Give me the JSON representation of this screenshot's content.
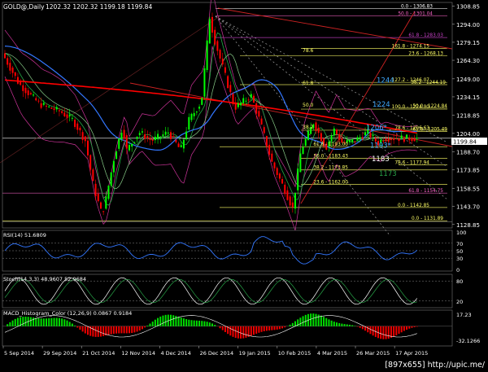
{
  "window": {
    "title": "GOLD@,Daily",
    "ohlc": "1202.32 1202.32 1199.18 1199.84",
    "watermark": "[897x655] http://upic.me/"
  },
  "price_axis": {
    "labels": [
      "1308.85",
      "1294.00",
      "1279.15",
      "1264.30",
      "1249.00",
      "1234.15",
      "1218.85",
      "1204.00",
      "1188.70",
      "1173.85",
      "1158.55",
      "1143.70",
      "1128.85"
    ],
    "current": "1199.84",
    "range": [
      1126,
      1312
    ]
  },
  "date_axis": [
    "5 Sep 2014",
    "29 Sep 2014",
    "21 Oct 2014",
    "12 Nov 2014",
    "4 Dec 2014",
    "26 Dec 2014",
    "19 Jan 2015",
    "10 Feb 2015",
    "4 Mar 2015",
    "26 Mar 2015",
    "17 Apr 2015"
  ],
  "fib_right": [
    {
      "label": "0.0 - 1306.83",
      "price": 1306.83,
      "color": "#ffffff"
    },
    {
      "label": "50.0 - 1301.04",
      "price": 1301.04,
      "color": "#ff66cc"
    },
    {
      "label": "61.8 - 1283.03",
      "price": 1283.03,
      "color": "#cc44cc"
    },
    {
      "label": "161.8 - 1274.15",
      "price": 1274.15,
      "color": "#ffff66"
    },
    {
      "label": "23.6 - 1268.13",
      "price": 1268.13,
      "color": "#ffff66"
    },
    {
      "label": "127.2 - 1246.07",
      "price": 1246.07,
      "color": "#ffff66"
    },
    {
      "label": "38.2 - 1244.19",
      "price": 1244.19,
      "color": "#ffff66"
    },
    {
      "label": "100.0 - 1224.00",
      "price": 1224.0,
      "color": "#ffff66"
    },
    {
      "label": "50.0 - 1224.84",
      "price": 1224.84,
      "color": "#ffff66"
    },
    {
      "label": "78.6 - 1206.63",
      "price": 1206.63,
      "color": "#ffff66"
    },
    {
      "label": "61.8 - 1205.49",
      "price": 1205.49,
      "color": "#ffff66"
    },
    {
      "label": "61.8 - 1193.00",
      "price": 1193.0,
      "color": "#ffff66"
    },
    {
      "label": "50.0 - 1183.43",
      "price": 1183.43,
      "color": "#ffff66"
    },
    {
      "label": "78.6 - 1177.94",
      "price": 1177.94,
      "color": "#ffff66"
    },
    {
      "label": "38.2 - 1173.85",
      "price": 1173.85,
      "color": "#ffff66"
    },
    {
      "label": "23.6 - 1162.00",
      "price": 1162.0,
      "color": "#ffff66"
    },
    {
      "label": "61.8 - 1154.75",
      "price": 1154.75,
      "color": "#ff66cc"
    },
    {
      "label": "0.0 - 1142.85",
      "price": 1142.85,
      "color": "#ffff66"
    },
    {
      "label": "0.0 - 1131.89",
      "price": 1131.89,
      "color": "#ffff66"
    }
  ],
  "fib_small": [
    "78.6",
    "61.8",
    "50.0",
    "38.2"
  ],
  "annotations": [
    {
      "text": "1244",
      "price": 1246,
      "color": "#3fa9ff"
    },
    {
      "text": "1224",
      "price": 1226,
      "color": "#3fa9ff"
    },
    {
      "text": "1206*",
      "price": 1207,
      "color": "#3fa9ff"
    },
    {
      "text": "1193*",
      "price": 1192,
      "color": "#3fa9ff"
    },
    {
      "text": "1183",
      "price": 1181,
      "color": "#ffffff"
    },
    {
      "text": "1173",
      "price": 1169,
      "color": "#27a347"
    }
  ],
  "rsi": {
    "title": "RSI(14) 51.6809",
    "labels": [
      "100",
      "70",
      "50",
      "30",
      "0"
    ]
  },
  "stoch": {
    "title": "Stoch(14,3,3) 48.9607 52.9684",
    "labels": [
      "80",
      "20"
    ]
  },
  "macd": {
    "title": "MACD_Histogram_Color (12,26,9) 0.0867 0.9184",
    "labels": [
      "17.23",
      "-32.1266"
    ]
  },
  "colors": {
    "bull": "#00ff00",
    "bear": "#ff0000",
    "ma_red": "#ff0000",
    "ma_blue": "#3377ff",
    "bands": "#cc3399",
    "fib": "#ffff66",
    "grid": "#333333",
    "text": "#ffffff"
  }
}
